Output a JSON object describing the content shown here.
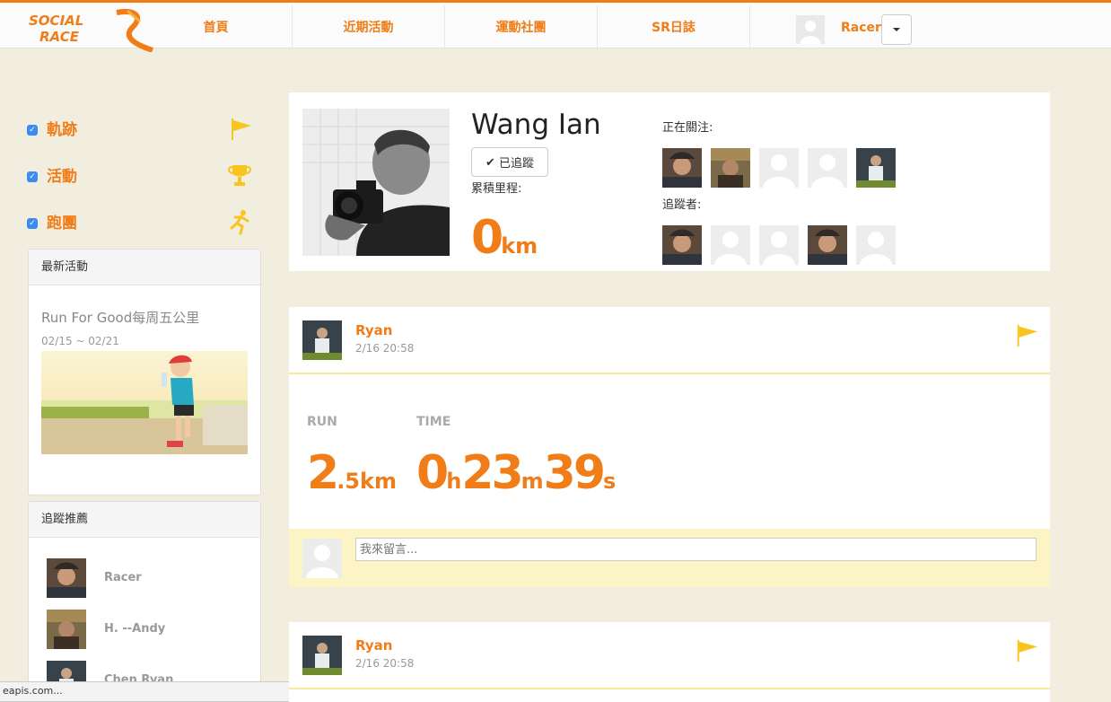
{
  "brand": {
    "logo_line1": "SOCIAL",
    "logo_line2": "RACE",
    "accent": "#f07d17",
    "highlight": "#fdf4c5"
  },
  "nav": {
    "items": [
      "首頁",
      "近期活動",
      "運動社團",
      "SR日誌"
    ],
    "username": "Racer"
  },
  "filters": [
    {
      "label": "軌跡",
      "checked": true,
      "icon": "flag-icon"
    },
    {
      "label": "活動",
      "checked": true,
      "icon": "trophy-icon"
    },
    {
      "label": "跑團",
      "checked": true,
      "icon": "runner-icon"
    }
  ],
  "latest_activity": {
    "heading": "最新活動",
    "title": "Run For Good每周五公里",
    "date_range": "02/15 ~ 02/21"
  },
  "recommendations": {
    "heading": "追蹤推薦",
    "users": [
      "Racer",
      "H. --Andy",
      "Chen Ryan"
    ]
  },
  "profile": {
    "name": "Wang Ian",
    "follow_button": "已追蹤",
    "distance_label": "累積里程:",
    "distance_value": "0",
    "distance_unit": "km",
    "following_label": "正在關注:",
    "followers_label": "追蹤者:"
  },
  "posts": [
    {
      "author": "Ryan",
      "time": "2/16 20:58",
      "run_label": "RUN",
      "time_label": "TIME",
      "distance_int": "2",
      "distance_dec": ".5km",
      "hours": "0",
      "hours_unit": "h",
      "minutes": "23",
      "minutes_unit": "m",
      "seconds": "39",
      "seconds_unit": "s",
      "comment_placeholder": "我來留言..."
    },
    {
      "author": "Ryan",
      "time": "2/16 20:58"
    }
  ],
  "status_bar": {
    "text": "eapis.com..."
  }
}
